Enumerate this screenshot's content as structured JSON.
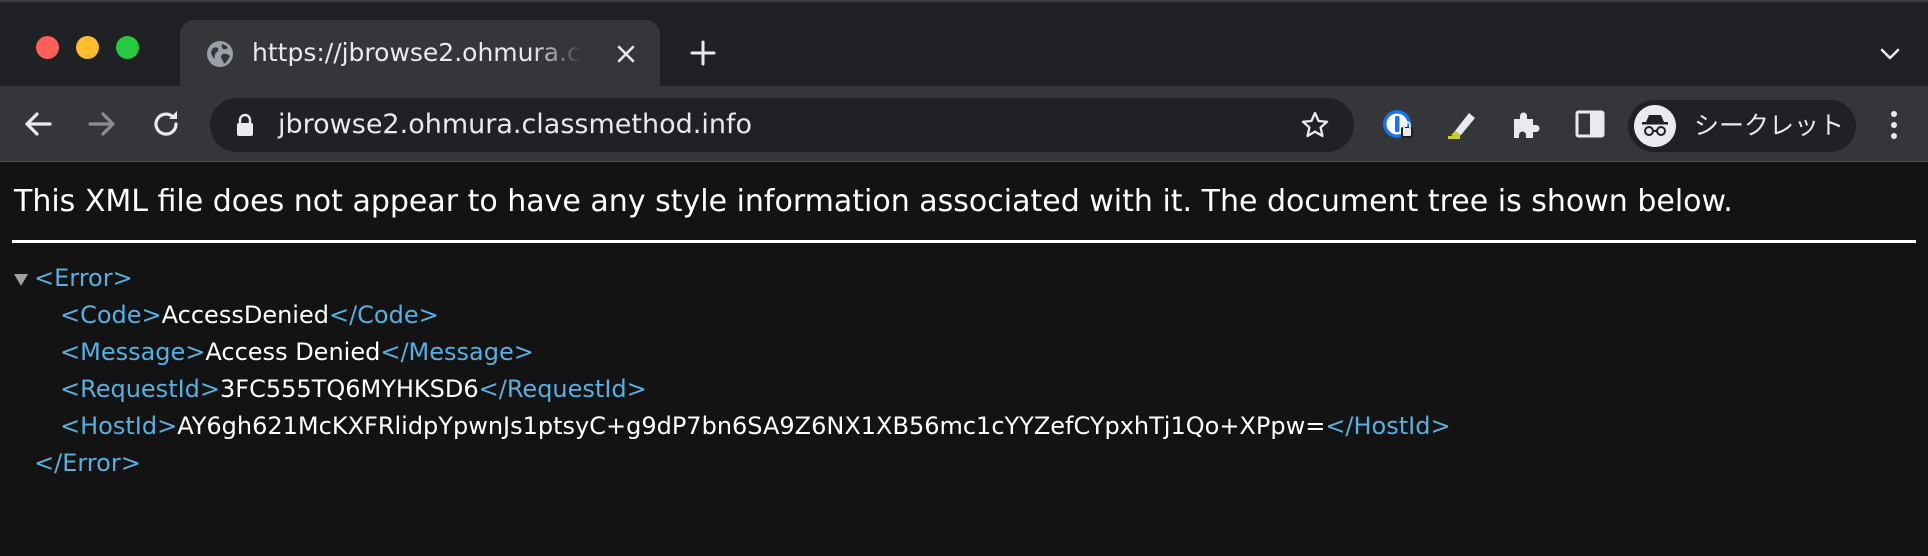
{
  "window": {
    "traffic_lights": [
      "close",
      "minimize",
      "zoom"
    ]
  },
  "tab": {
    "title": "https://jbrowse2.ohmura.classmethod.info",
    "favicon": "globe-icon",
    "close_icon": "close-icon"
  },
  "tabstrip": {
    "new_tab_icon": "plus-icon",
    "tab_search_icon": "chevron-down-icon"
  },
  "toolbar": {
    "back_icon": "arrow-left-icon",
    "forward_icon": "arrow-right-icon",
    "reload_icon": "reload-icon",
    "url": "jbrowse2.ohmura.classmethod.info",
    "bookmark_icon": "star-icon",
    "profile_label": "シークレット",
    "colors": {
      "chrome_dark": "#202124",
      "toolbar": "#35363a",
      "text": "#e8eaed"
    }
  },
  "content": {
    "notice": "This XML file does not appear to have any style information associated with it. The document tree is shown below.",
    "xml": {
      "root_open": "<Error>",
      "root_close": "</Error>",
      "code_open": "<Code>",
      "code_value": "AccessDenied",
      "code_close": "</Code>",
      "message_open": "<Message>",
      "message_value": "Access Denied",
      "message_close": "</Message>",
      "requestid_open": "<RequestId>",
      "requestid_value": "3FC555TQ6MYHKSD6",
      "requestid_close": "</RequestId>",
      "hostid_open": "<HostId>",
      "hostid_value": "AY6gh621McKXFRlidpYpwnJs1ptsyC+g9dP7bn6SA9Z6NX1XB56mc1cYYZefCYpxhTj1Qo+XPpw=",
      "hostid_close": "</HostId>"
    },
    "colors": {
      "tag": "#5aaee0",
      "text": "#ffffff",
      "background": "#131313"
    }
  }
}
